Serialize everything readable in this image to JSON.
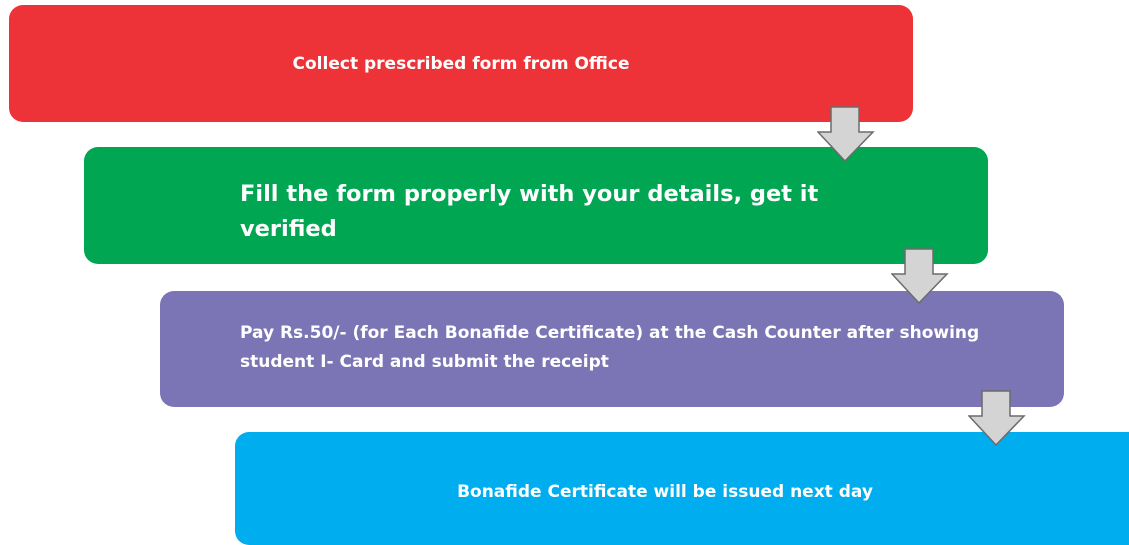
{
  "colors": {
    "step1": "#ee3338",
    "step2": "#00a651",
    "step3": "#7c75b5",
    "step4": "#00aeef",
    "arrow_fill": "#d4d4d4",
    "arrow_stroke": "#6b6b6b"
  },
  "steps": [
    {
      "text": "Collect prescribed form from Office"
    },
    {
      "text": "Fill the form properly with your details, get it verified"
    },
    {
      "text": "Pay Rs.50/- (for Each Bonafide Certificate) at the Cash Counter after showing student I- Card and submit the receipt"
    },
    {
      "text": "Bonafide Certificate will be issued next day"
    }
  ],
  "arrows": [
    {
      "icon": "down-arrow-icon"
    },
    {
      "icon": "down-arrow-icon"
    },
    {
      "icon": "down-arrow-icon"
    }
  ]
}
